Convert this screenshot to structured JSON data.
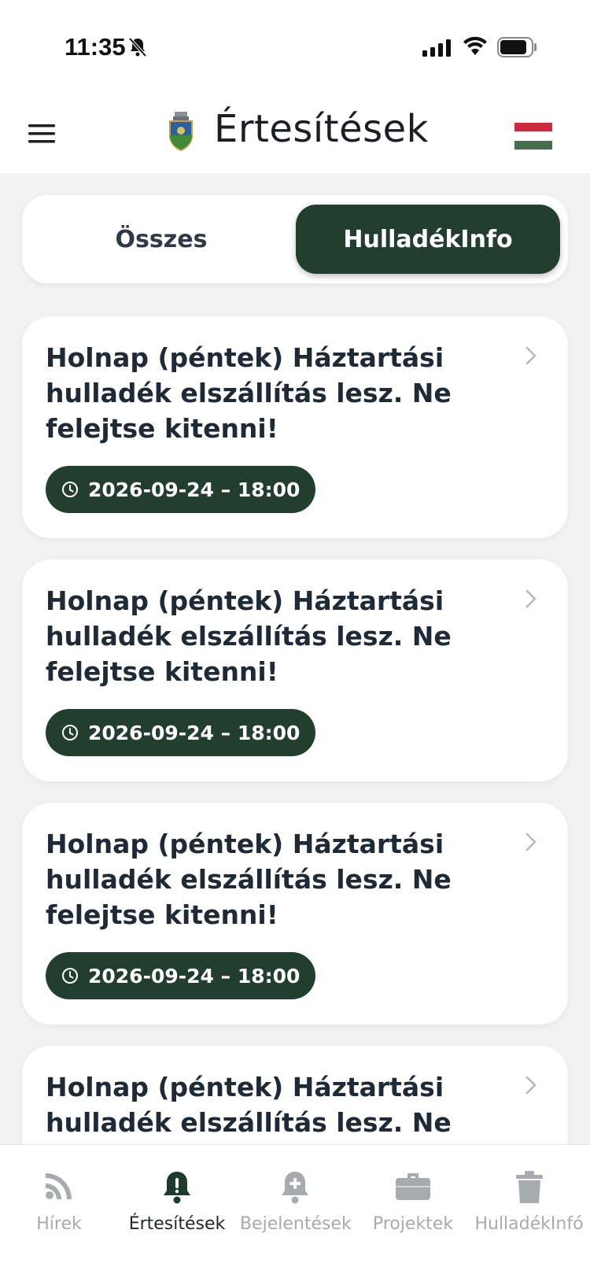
{
  "status_bar": {
    "time": "11:35"
  },
  "header": {
    "title": "Értesítések"
  },
  "tabs": [
    {
      "label": "Összes",
      "selected": false
    },
    {
      "label": "HulladékInfo",
      "selected": true
    }
  ],
  "notifications": [
    {
      "title": "Holnap (péntek) Háztartási hulladék elszállítás lesz. Ne felejtse kitenni!",
      "datetime": "2026-09-24 – 18:00"
    },
    {
      "title": "Holnap (péntek) Háztartási hulladék elszállítás lesz. Ne felejtse kitenni!",
      "datetime": "2026-09-24 – 18:00"
    },
    {
      "title": "Holnap (péntek) Háztartási hulladék elszállítás lesz. Ne felejtse kitenni!",
      "datetime": "2026-09-24 – 18:00"
    },
    {
      "title": "Holnap (péntek) Háztartási hulladék elszállítás lesz. Ne",
      "datetime": ""
    }
  ],
  "bottom_nav": [
    {
      "label": "Hírek",
      "icon": "rss-icon",
      "active": false
    },
    {
      "label": "Értesítések",
      "icon": "alert-bell-icon",
      "active": true
    },
    {
      "label": "Bejelentések",
      "icon": "bell-plus-icon",
      "active": false
    },
    {
      "label": "Projektek",
      "icon": "briefcase-icon",
      "active": false
    },
    {
      "label": "HulladékInfó",
      "icon": "trash-icon",
      "active": false
    }
  ],
  "colors": {
    "accent": "#213e2f",
    "background": "#f1f2f1",
    "inactive_nav": "#a6abae"
  }
}
